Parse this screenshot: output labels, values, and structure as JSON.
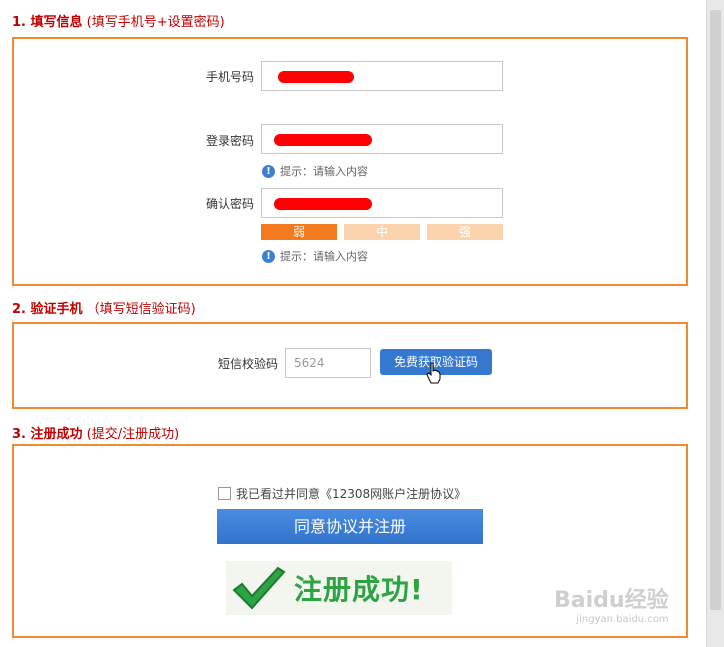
{
  "section1": {
    "title_main": "1. 填写信息",
    "title_sub": "(填写手机号+设置密码)",
    "phone_label": "手机号码",
    "password_label": "登录密码",
    "password_hint": "提示：请输入内容",
    "confirm_label": "确认密码",
    "strength": {
      "weak": "弱",
      "medium": "中",
      "strong": "强"
    },
    "confirm_hint": "提示：请输入内容"
  },
  "section2": {
    "title_main": "2. 验证手机",
    "title_sub": "（填写短信验证码)",
    "sms_label": "短信校验码",
    "sms_value": "5624",
    "get_code_button": "免费获取验证码"
  },
  "section3": {
    "title_main": "3. 注册成功",
    "title_sub": "(提交/注册成功)",
    "agree_text": "我已看过并同意《12308网账户注册协议》",
    "register_button": "同意协议并注册",
    "success_text": "注册成功!"
  },
  "watermark": {
    "brand": "Baidu经验",
    "url": "jingyan.baidu.com"
  },
  "colors": {
    "title_red": "#c00000",
    "panel_border": "#f08a2c",
    "button_blue": "#3578d0",
    "weak": "#f47a20",
    "medium": "#fbd4ae",
    "strong": "#fbd4ae",
    "success_green": "#2ea343"
  }
}
